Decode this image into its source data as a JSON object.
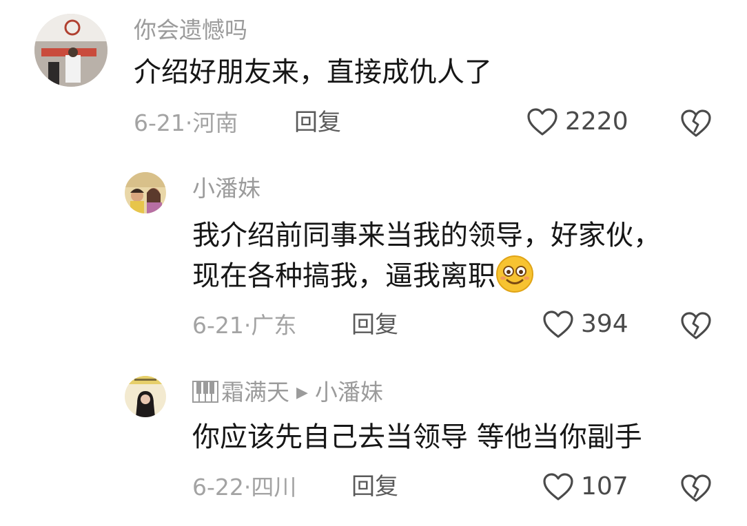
{
  "comments": [
    {
      "username": "你会遗憾吗",
      "text": "介绍好朋友来，直接成仇人了",
      "date_location": "6-21·河南",
      "reply_label": "回复",
      "likes": "2220"
    },
    {
      "username": "小潘妹",
      "text": "我介绍前同事来当我的领导，好家伙，现在各种搞我，逼我离职",
      "date_location": "6-21·广东",
      "reply_label": "回复",
      "likes": "394"
    },
    {
      "username": "霜满天",
      "reply_to": "小潘妹",
      "text": "你应该先自己去当领导 等他当你副手",
      "date_location": "6-22·四川",
      "reply_label": "回复",
      "likes": "107"
    }
  ],
  "icons": {
    "like": "heart-outline-icon",
    "dislike": "broken-heart-icon",
    "emoji": "smiling-face-emoji",
    "piano": "piano-keys-icon",
    "reply_arrow": "triangle-right-icon"
  },
  "colors": {
    "username": "#9b9b9b",
    "text": "#161616",
    "meta": "#a3a3a3",
    "emoji_face": "#f7c331"
  }
}
